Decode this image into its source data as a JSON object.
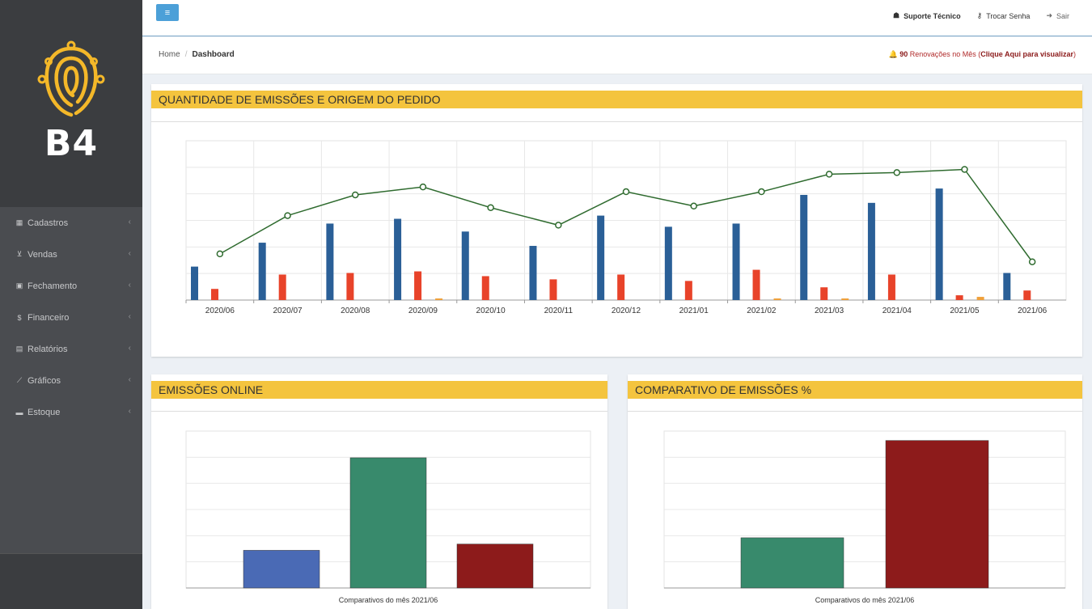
{
  "brand": {
    "logo_text": "B4",
    "logo_color": "#f4b829"
  },
  "topbar": {
    "menu_toggle_icon": "hamburger-icon",
    "links": [
      {
        "label": "Suporte Técnico",
        "icon": "headset-icon"
      },
      {
        "label": "Trocar Senha",
        "icon": "key-icon"
      },
      {
        "label": "Sair",
        "icon": "sign-out-icon"
      }
    ]
  },
  "breadcrumb": {
    "home": "Home",
    "separator": "/",
    "current": "Dashboard"
  },
  "renewals": {
    "count": "90",
    "text": " Renovações no Mês (",
    "link": "Clique Aqui para visualizar",
    "close": ")"
  },
  "sidebar": {
    "items": [
      {
        "label": "Cadastros",
        "icon": "list-icon"
      },
      {
        "label": "Vendas",
        "icon": "cart-icon"
      },
      {
        "label": "Fechamento",
        "icon": "money-icon"
      },
      {
        "label": "Financeiro",
        "icon": "dollar-icon"
      },
      {
        "label": "Relatórios",
        "icon": "table-icon"
      },
      {
        "label": "Gráficos",
        "icon": "line-chart-icon"
      },
      {
        "label": "Estoque",
        "icon": "card-icon"
      }
    ]
  },
  "panels": {
    "quantidade": {
      "title": "QUANTIDADE DE EMISSÕES E ORIGEM DO PEDIDO"
    },
    "online": {
      "title": "EMISSÕES ONLINE"
    },
    "comparativo": {
      "title": "COMPARATIVO DE EMISSÕES %"
    }
  },
  "chart_data": [
    {
      "type": "bar",
      "categories": [
        "2020/06",
        "2020/07",
        "2020/08",
        "2020/09",
        "2020/10",
        "2020/11",
        "2020/12",
        "2021/01",
        "2021/02",
        "2021/03",
        "2021/04",
        "2021/05",
        "2021/06"
      ],
      "ylim": [
        0,
        100
      ],
      "grid": true,
      "series": [
        {
          "kind": "bar",
          "color": "#2a5f97",
          "values": [
            21,
            36,
            48,
            51,
            43,
            34,
            53,
            46,
            48,
            66,
            61,
            70,
            17
          ]
        },
        {
          "kind": "bar",
          "color": "#e8432a",
          "values": [
            7,
            16,
            17,
            18,
            15,
            13,
            16,
            12,
            19,
            8,
            16,
            3,
            6
          ]
        },
        {
          "kind": "bar",
          "color": "#f0a03a",
          "values": [
            0,
            0,
            0,
            1,
            0,
            0,
            0,
            0,
            1,
            1,
            0,
            2,
            0
          ]
        },
        {
          "kind": "line",
          "color": "#2f6b2f",
          "values": [
            29,
            53,
            66,
            71,
            58,
            47,
            68,
            59,
            68,
            79,
            80,
            82,
            24
          ]
        }
      ]
    },
    {
      "type": "bar",
      "categories": [
        ""
      ],
      "xlabel": "Comparativos do mês 2021/06",
      "ylim": [
        0,
        100
      ],
      "grid": true,
      "series": [
        {
          "color": "#4a6ab5",
          "values": [
            24
          ]
        },
        {
          "color": "#388a6c",
          "values": [
            83
          ]
        },
        {
          "color": "#8d1b1b",
          "values": [
            28
          ]
        }
      ]
    },
    {
      "type": "bar",
      "categories": [
        ""
      ],
      "xlabel": "Comparativos do mês 2021/06",
      "ylim": [
        0,
        100
      ],
      "grid": true,
      "series": [
        {
          "color": "#388a6c",
          "values": [
            32
          ]
        },
        {
          "color": "#8d1b1b",
          "values": [
            94
          ]
        }
      ]
    }
  ]
}
